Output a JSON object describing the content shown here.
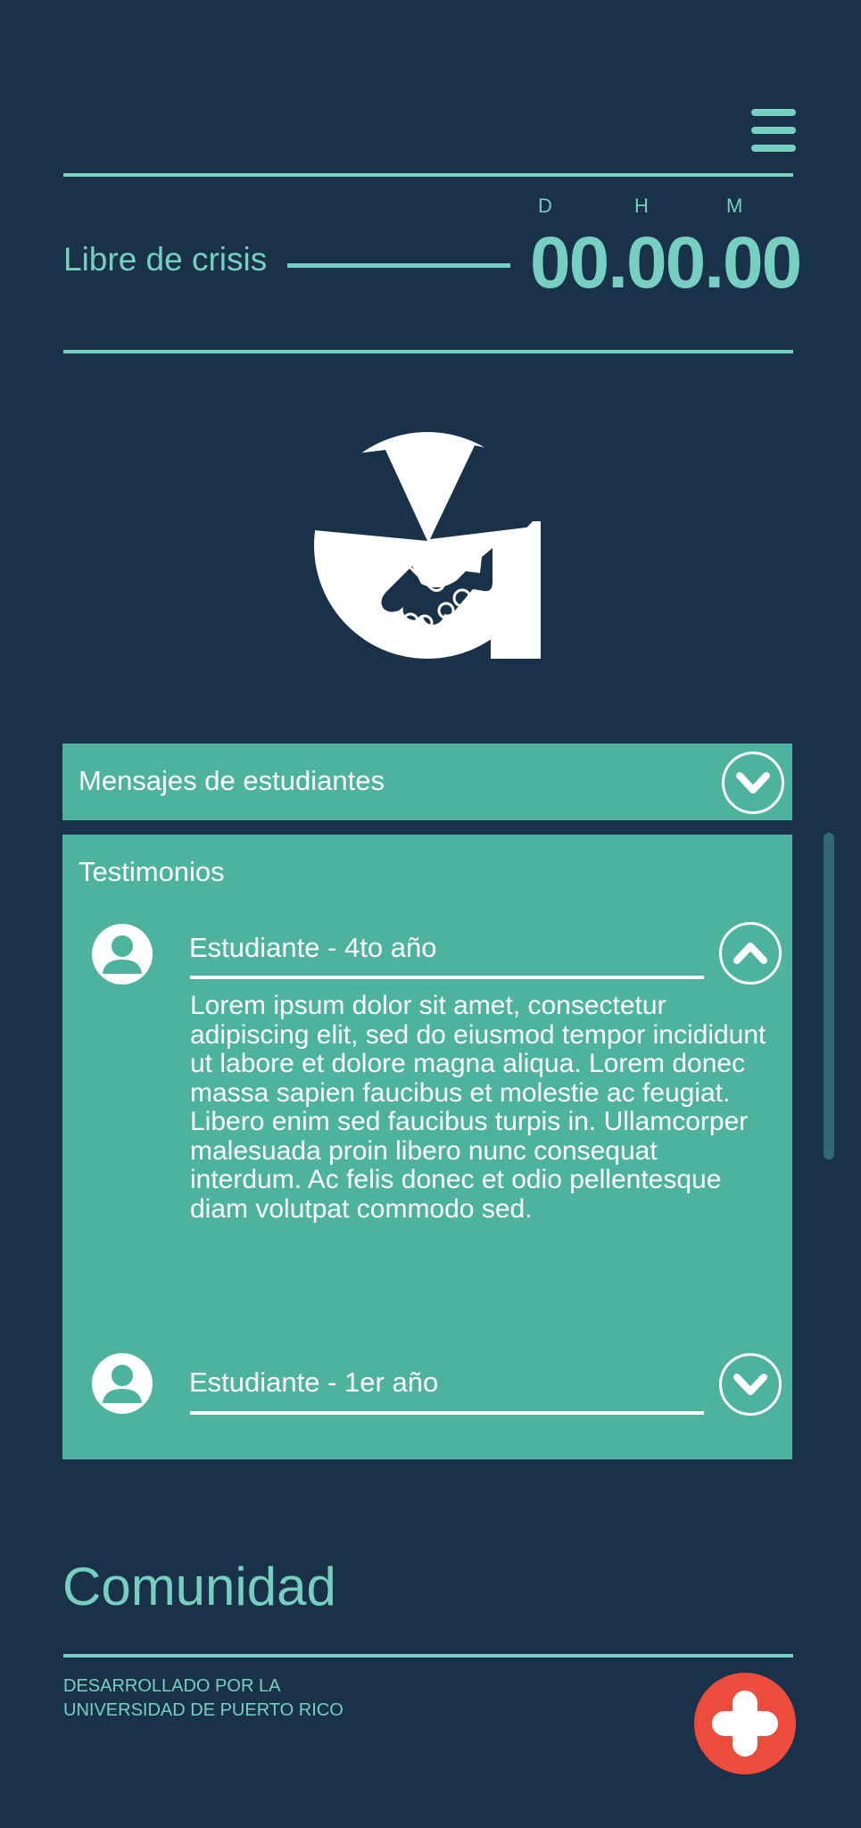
{
  "header": {
    "menu_icon": "hamburger-menu-icon",
    "crisis_label": "Libre de crisis",
    "units": {
      "days": "D",
      "hours": "H",
      "minutes": "M"
    },
    "timer": "00.00.00"
  },
  "logo": {
    "icon": "holding-hands-icon"
  },
  "accordion": {
    "header_title": "Mensajes de estudiantes",
    "header_toggle_icon": "chevron-down-icon",
    "panel_title": "Testimonios",
    "testimonials": [
      {
        "name": "Estudiante - 4to año",
        "expanded": true,
        "toggle_icon": "chevron-up-icon",
        "text": "Lorem ipsum dolor sit amet, consectetur adipiscing elit, sed do eiusmod tempor incididunt ut labore et dolore magna aliqua. Lorem donec massa sapien faucibus et molestie ac feugiat. Libero enim sed faucibus turpis in. Ullamcorper malesuada proin libero nunc consequat interdum. Ac felis donec et odio pellentesque diam volutpat commodo sed."
      },
      {
        "name": "Estudiante - 1er año",
        "expanded": false,
        "toggle_icon": "chevron-down-icon"
      }
    ]
  },
  "community": {
    "title": "Comunidad"
  },
  "footer": {
    "credit_line1": "DESARROLLADO POR LA",
    "credit_line2": "UNIVERSIDAD DE PUERTO RICO",
    "fab_icon": "plus-icon"
  },
  "colors": {
    "background": "#1a3249",
    "accent": "#76cfc0",
    "panel": "#4db39f",
    "fab": "#ed4b3c"
  }
}
